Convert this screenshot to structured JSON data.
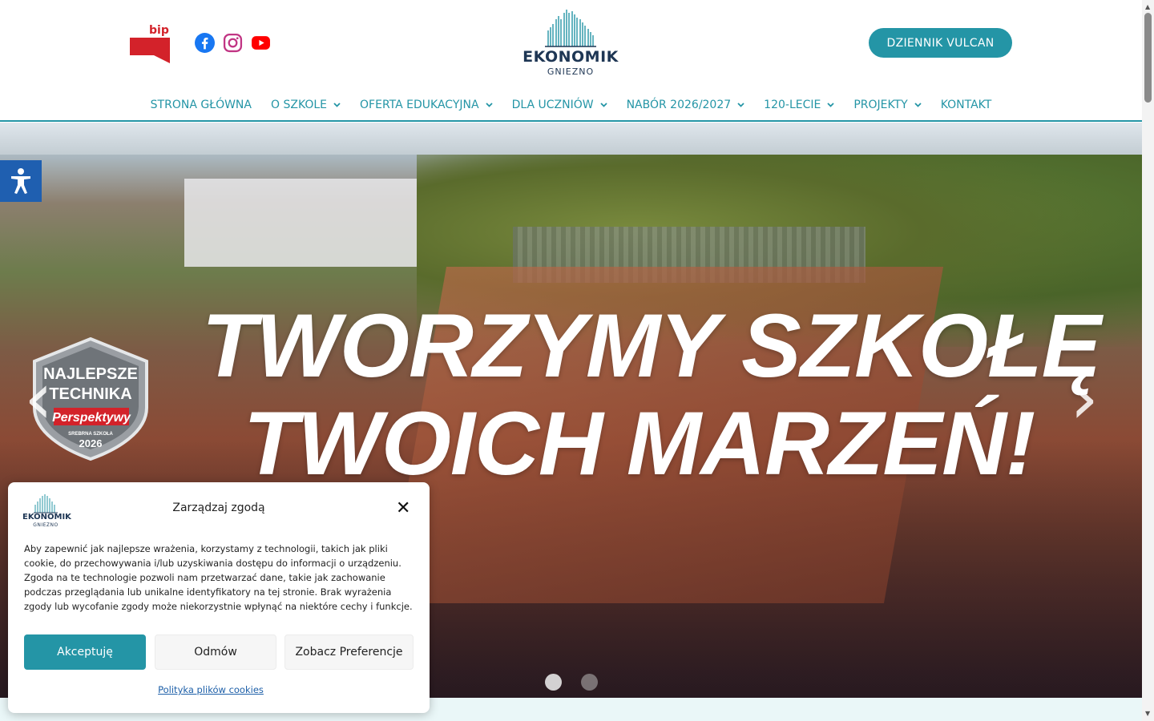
{
  "header": {
    "bip_label": "bip",
    "logo": {
      "name": "EKONOMIK",
      "subtitle": "GNIEZNO"
    },
    "vulcan_button": "DZIENNIK VULCAN",
    "social": [
      "facebook-icon",
      "instagram-icon",
      "youtube-icon"
    ]
  },
  "nav": {
    "items": [
      {
        "label": "STRONA GŁÓWNA",
        "has_dropdown": false
      },
      {
        "label": "O SZKOLE",
        "has_dropdown": true
      },
      {
        "label": "OFERTA EDUKACYJNA",
        "has_dropdown": true
      },
      {
        "label": "DLA UCZNIÓW",
        "has_dropdown": true
      },
      {
        "label": "NABÓR 2026/2027",
        "has_dropdown": true
      },
      {
        "label": "120-LECIE",
        "has_dropdown": true
      },
      {
        "label": "PROJEKTY",
        "has_dropdown": true
      },
      {
        "label": "KONTAKT",
        "has_dropdown": false
      }
    ],
    "chevron": "⌄"
  },
  "hero": {
    "title_line1": "TWORZYMY SZKOŁĘ",
    "title_line2": "TWOICH MARZEŃ!",
    "badge": {
      "line1": "NAJLEPSZE",
      "line2": "TECHNIKA",
      "brand": "Perspektywy",
      "line3": "SREBRNA SZKOŁA",
      "year": "2026"
    },
    "prev_arrow": "‹",
    "next_arrow": "›",
    "slides": 2,
    "active_slide": 1
  },
  "cookie": {
    "logo": {
      "name": "EKONOMIK",
      "subtitle": "GNIEZNO"
    },
    "title": "Zarządzaj zgodą",
    "close": "✕",
    "text": "Aby zapewnić jak najlepsze wrażenia, korzystamy z technologii, takich jak pliki cookie, do przechowywania i/lub uzyskiwania dostępu do informacji o urządzeniu. Zgoda na te technologie pozwoli nam przetwarzać dane, takie jak zachowanie podczas przeglądania lub unikalne identyfikatory na tej stronie. Brak wyrażenia zgody lub wycofanie zgody może niekorzystnie wpłynąć na niektóre cechy i funkcje.",
    "accept": "Akceptuję",
    "deny": "Odmów",
    "prefs": "Zobacz Preferencje",
    "policy_link": "Polityka plików cookies"
  },
  "colors": {
    "accent": "#2495a6",
    "brand_dark": "#1e3654",
    "bip_red": "#d3222a",
    "accessibility_blue": "#1f5fb0"
  }
}
